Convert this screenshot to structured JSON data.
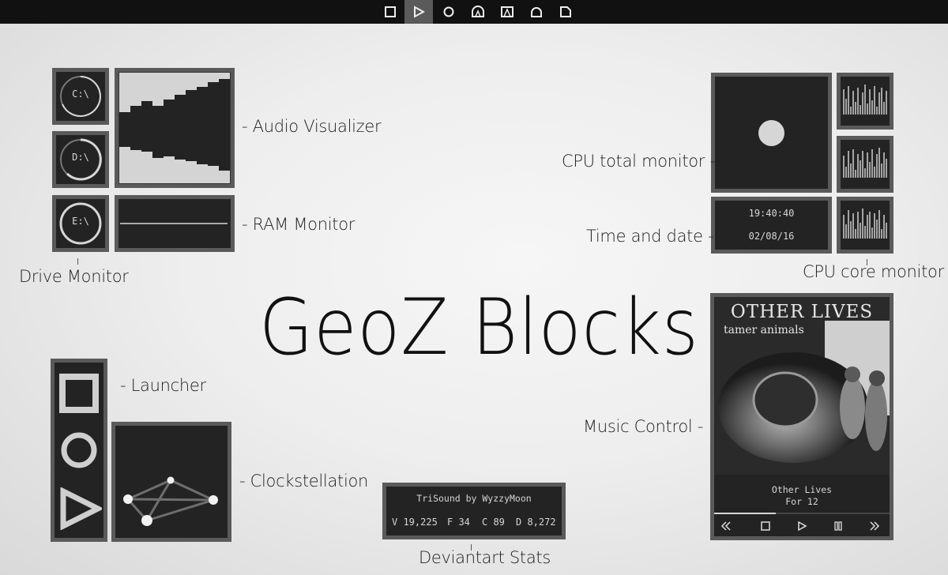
{
  "topbar": {
    "buttons": [
      {
        "icon": "square-icon",
        "active": false
      },
      {
        "icon": "play-triangle-icon",
        "active": true
      },
      {
        "icon": "circle-icon",
        "active": false
      },
      {
        "icon": "arch-icon",
        "active": false
      },
      {
        "icon": "mountain-icon",
        "active": false
      },
      {
        "icon": "ring-icon",
        "active": false
      },
      {
        "icon": "folder-corner-icon",
        "active": false
      }
    ]
  },
  "title": "GeoZ Blocks",
  "labels": {
    "audio_visualizer": "- Audio Visualizer",
    "ram_monitor": "- RAM Monitor",
    "drive_monitor": "Drive Monitor",
    "cpu_total": "CPU total monitor -",
    "time_date": "Time and date -",
    "cpu_core": "CPU core monitor",
    "launcher": "- Launcher",
    "clockstellation": "- Clockstellation",
    "music_control": "Music Control -",
    "deviantart_stats": "Deviantart Stats"
  },
  "drives": [
    {
      "name": "C:\\"
    },
    {
      "name": "D:\\"
    },
    {
      "name": "E:\\"
    }
  ],
  "clock": {
    "time": "19:40:40",
    "date": "02/08/16"
  },
  "music": {
    "album_artist": "OTHER LIVES",
    "album_title": "tamer animals",
    "track_artist": "Other Lives",
    "track_title": "For 12",
    "progress": 0.35
  },
  "deviantart": {
    "title": "TriSound by WyzzyMoon",
    "views": "V 19,225",
    "favs": "F 34",
    "comments": "C 89",
    "downloads": "D 8,272"
  },
  "colors": {
    "frame": "#5a5a5a",
    "panel": "#232323",
    "foreground": "#d6d6d6",
    "topbar": "#111111"
  }
}
